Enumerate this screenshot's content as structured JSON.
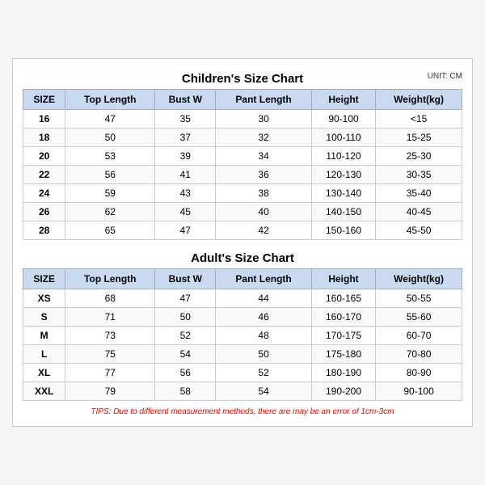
{
  "children_title": "Children's Size Chart",
  "adult_title": "Adult's Size Chart",
  "unit_label": "UNIT: CM",
  "columns": [
    "SIZE",
    "Top Length",
    "Bust W",
    "Pant Length",
    "Height",
    "Weight(kg)"
  ],
  "children_rows": [
    [
      "16",
      "47",
      "35",
      "30",
      "90-100",
      "<15"
    ],
    [
      "18",
      "50",
      "37",
      "32",
      "100-110",
      "15-25"
    ],
    [
      "20",
      "53",
      "39",
      "34",
      "110-120",
      "25-30"
    ],
    [
      "22",
      "56",
      "41",
      "36",
      "120-130",
      "30-35"
    ],
    [
      "24",
      "59",
      "43",
      "38",
      "130-140",
      "35-40"
    ],
    [
      "26",
      "62",
      "45",
      "40",
      "140-150",
      "40-45"
    ],
    [
      "28",
      "65",
      "47",
      "42",
      "150-160",
      "45-50"
    ]
  ],
  "adult_rows": [
    [
      "XS",
      "68",
      "47",
      "44",
      "160-165",
      "50-55"
    ],
    [
      "S",
      "71",
      "50",
      "46",
      "160-170",
      "55-60"
    ],
    [
      "M",
      "73",
      "52",
      "48",
      "170-175",
      "60-70"
    ],
    [
      "L",
      "75",
      "54",
      "50",
      "175-180",
      "70-80"
    ],
    [
      "XL",
      "77",
      "56",
      "52",
      "180-190",
      "80-90"
    ],
    [
      "XXL",
      "79",
      "58",
      "54",
      "190-200",
      "90-100"
    ]
  ],
  "tips": "TIPS: Due to different measurement methods, there are may be an error of 1cm-3cm"
}
